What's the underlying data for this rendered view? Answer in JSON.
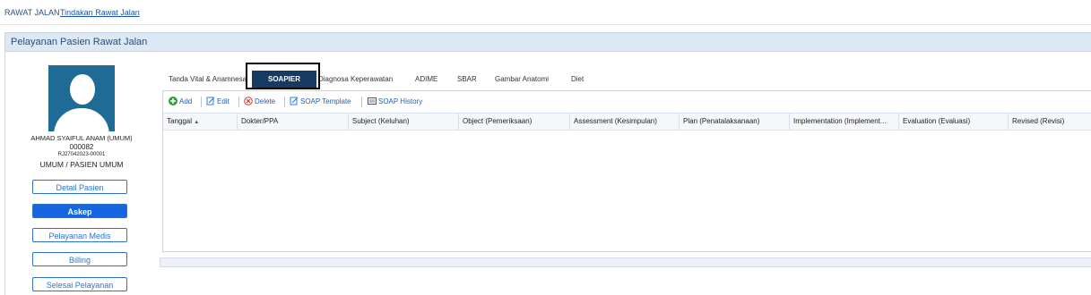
{
  "breadcrumb": {
    "first": "RAWAT JALAN",
    "second": "Tindakan Rawat Jalan"
  },
  "panel": {
    "title": "Pelayanan Pasien Rawat Jalan"
  },
  "patient": {
    "name": "AHMAD SYAIFUL ANAM (UMUM)",
    "id": "000082",
    "registration": "RJ27042023-00001",
    "type": "UMUM / PASIEN UMUM"
  },
  "sidebar_buttons": [
    "Detail Pasien",
    "Askep",
    "Pelayanan Medis",
    "Billing",
    "Selesai Pelayanan"
  ],
  "tabs": [
    "Tanda Vital & Anamnesa",
    "SOAPIER",
    "Diagnosa Keperawatan",
    "ADIME",
    "SBAR",
    "Gambar Anatomi",
    "Diet"
  ],
  "active_tab": "SOAPIER",
  "toolbar": {
    "add": "Add",
    "edit": "Edit",
    "delete": "Delete",
    "soap_template": "SOAP Template",
    "soap_history": "SOAP History"
  },
  "table": {
    "sort_indicator": "▲",
    "columns": [
      "Tanggal",
      "Dokter/PPA",
      "Subject (Keluhan)",
      "Object (Pemeriksaan)",
      "Assessment (Kesimpulan)",
      "Plan (Penatalaksanaan)",
      "Implementation (Implement...",
      "Evaluation (Evaluasi)",
      "Revised (Revisi)"
    ],
    "rows": []
  },
  "colors": {
    "accent": "#1565e0",
    "tab_active": "#173a63",
    "header_bg": "#dde8f5",
    "link": "#1f5fb5"
  },
  "icons": {
    "add": "plus-circle-icon",
    "edit": "edit-icon",
    "delete": "delete-icon",
    "soap_template": "template-icon",
    "soap_history": "history-icon",
    "avatar": "user-avatar-icon"
  }
}
